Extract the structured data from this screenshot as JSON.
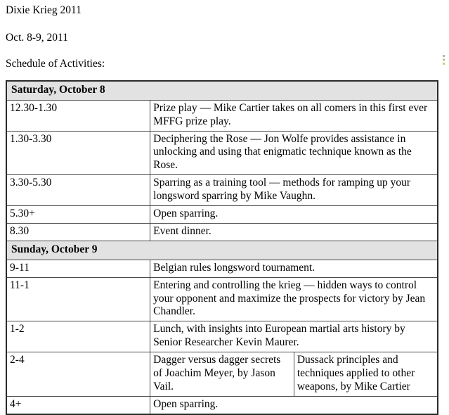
{
  "document": {
    "title": "Dixie Krieg 2011",
    "dates": "Oct. 8-9, 2011",
    "subtitle": "Schedule of Activities:"
  },
  "schedule": {
    "sections": [
      {
        "day_label": "Saturday, October 8",
        "rows": [
          {
            "time": "12.30-1.30",
            "description": "Prize play — Mike Cartier takes on all comers in this first ever MFFG prize play."
          },
          {
            "time": "1.30-3.30",
            "description": "Deciphering the Rose — Jon Wolfe provides assistance in unlocking and using that enigmatic technique known as the Rose."
          },
          {
            "time": "3.30-5.30",
            "description": "Sparring as a training tool — methods for ramping up your longsword sparring by Mike Vaughn."
          },
          {
            "time": "5.30+",
            "description": "Open sparring."
          },
          {
            "time": "8.30",
            "description": "Event dinner."
          }
        ]
      },
      {
        "day_label": "Sunday, October 9",
        "rows": [
          {
            "time": "9-11",
            "description": "Belgian rules longsword tournament."
          },
          {
            "time": "11-1",
            "description": "Entering and controlling the krieg — hidden ways to control your opponent and maximize the prospects for victory by Jean Chandler."
          },
          {
            "time": "1-2",
            "description": "Lunch, with insights into European martial arts history by Senior Researcher Kevin Maurer."
          },
          {
            "time": "2-4",
            "description_left": "Dagger versus dagger secrets of Joachim Meyer, by Jason Vail.",
            "description_right": "Dussack principles and techniques applied to other weapons, by Mike Cartier"
          },
          {
            "time": "4+",
            "description": "Open sparring."
          }
        ]
      }
    ]
  },
  "colors": {
    "day_header_background": "#e2e2e2",
    "table_outer_border": "#2a2a2a",
    "table_inner_border": "#4a4a4a",
    "text": "#000000",
    "page_background": "#ffffff"
  }
}
